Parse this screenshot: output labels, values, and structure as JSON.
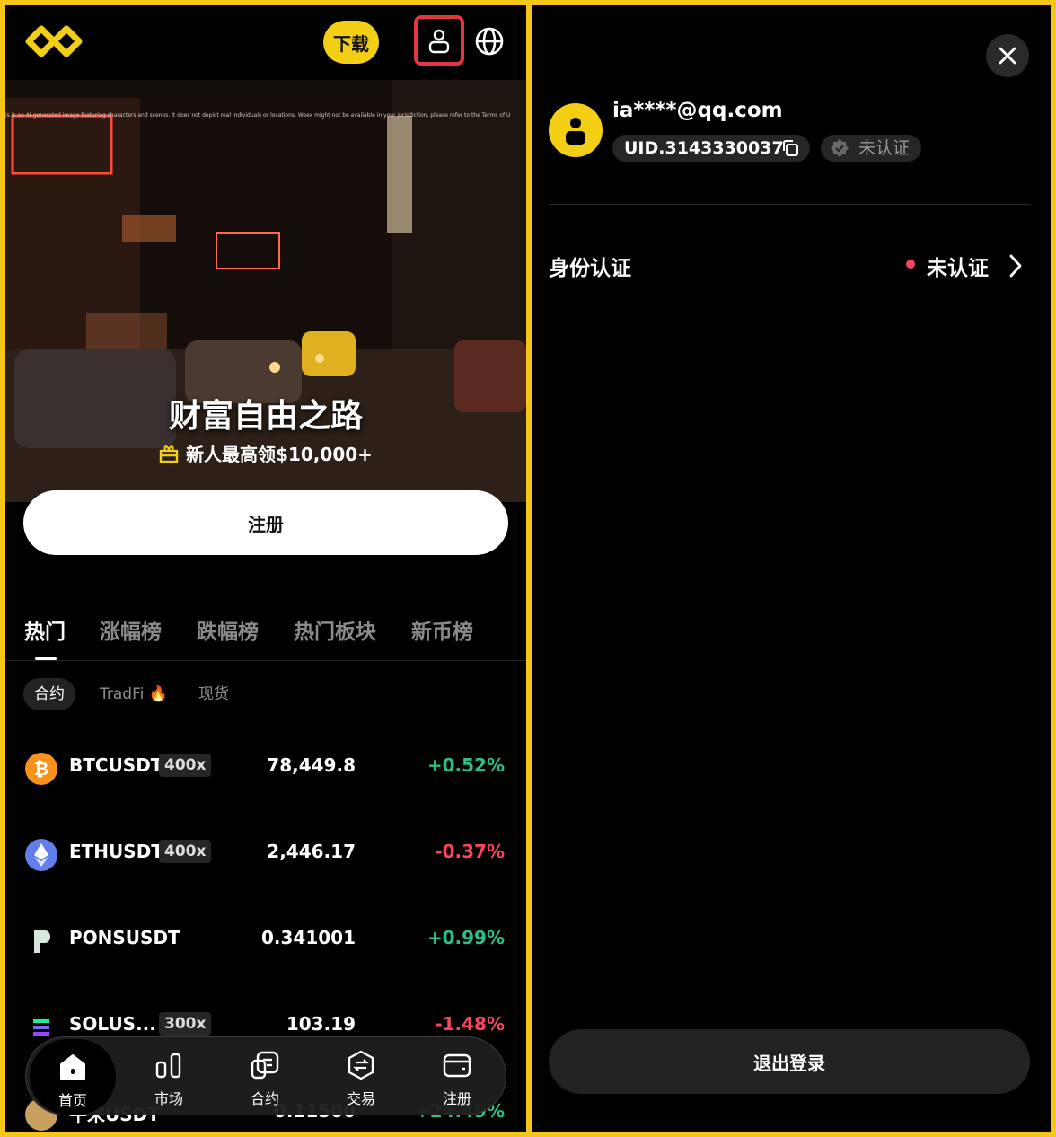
{
  "header": {
    "download_label": "下载"
  },
  "hero": {
    "disclaimer": "is is an AI-generated image featuring characters and scenes. It does not depict real individuals or locations. Weex might not be available in your jurisdiction, please refer to the Terms of U",
    "title": "财富自由之路",
    "subtitle": "新人最高领$10,000+",
    "register_label": "注册"
  },
  "tabs": [
    "热门",
    "涨幅榜",
    "跌幅榜",
    "热门板块",
    "新币榜"
  ],
  "chips": [
    "合约",
    "TradFi 🔥",
    "现货"
  ],
  "markets": [
    {
      "symbol": "BTCUSDT",
      "leverage": "400x",
      "price": "78,449.8",
      "change": "+0.52%",
      "dir": "up",
      "color": "#f7931a"
    },
    {
      "symbol": "ETHUSDT",
      "leverage": "400x",
      "price": "2,446.17",
      "change": "-0.37%",
      "dir": "down",
      "color": "#627eea"
    },
    {
      "symbol": "PONSUSDT",
      "leverage": "",
      "price": "0.341001",
      "change": "+0.99%",
      "dir": "up",
      "color": "#d8e6dc"
    },
    {
      "symbol": "SOLUS...",
      "leverage": "300x",
      "price": "103.19",
      "change": "-1.48%",
      "dir": "down",
      "color": "#9945ff"
    },
    {
      "symbol": "牛来USDT",
      "leverage": "",
      "price": "0.11500",
      "change": "+24.49%",
      "dir": "up",
      "color": "#c8a060"
    }
  ],
  "bottom_nav": [
    {
      "label": "首页",
      "icon": "home-icon"
    },
    {
      "label": "市场",
      "icon": "market-bars-icon"
    },
    {
      "label": "合约",
      "icon": "contract-icon"
    },
    {
      "label": "交易",
      "icon": "trade-exchange-icon"
    },
    {
      "label": "注册",
      "icon": "wallet-icon"
    }
  ],
  "account": {
    "email": "ia****@qq.com",
    "uid": "UID.3143330037",
    "verify_badge": "未认证",
    "identity_label": "身份认证",
    "identity_status": "未认证",
    "logout_label": "退出登录"
  }
}
